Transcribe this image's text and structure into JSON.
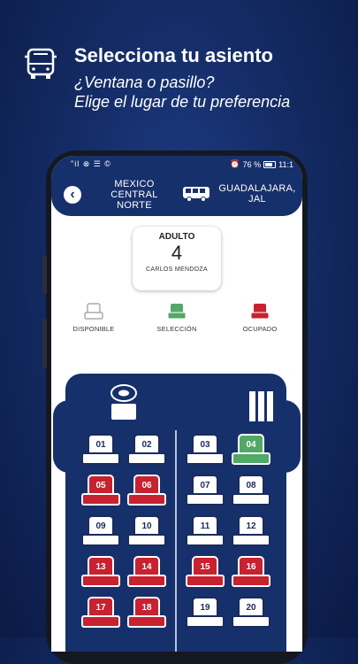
{
  "promo": {
    "title": "Selecciona tu asiento",
    "subtitle_line1": "¿Ventana o pasillo?",
    "subtitle_line2": "Elige el lugar de tu preferencia"
  },
  "status_bar": {
    "left": "\"il ⊗ ☰ ©",
    "battery": "76 %",
    "time": "11:1"
  },
  "header": {
    "origin": "MEXICO CENTRAL NORTE",
    "destination": "GUADALAJARA, JAL"
  },
  "passenger": {
    "type": "ADULTO",
    "number": "4",
    "name": "CARLOS MENDOZA"
  },
  "legend": {
    "available": "DISPONIBLE",
    "selected": "SELECCIÓN",
    "occupied": "OCUPADO"
  },
  "colors": {
    "brand_navy": "#16306b",
    "occupied_red": "#c8212f",
    "selected_green": "#52a866"
  },
  "seats": [
    {
      "number": "01",
      "status": "disponible"
    },
    {
      "number": "02",
      "status": "disponible"
    },
    {
      "number": "03",
      "status": "disponible"
    },
    {
      "number": "04",
      "status": "seleccion"
    },
    {
      "number": "05",
      "status": "ocupado"
    },
    {
      "number": "06",
      "status": "ocupado"
    },
    {
      "number": "07",
      "status": "disponible"
    },
    {
      "number": "08",
      "status": "disponible"
    },
    {
      "number": "09",
      "status": "disponible"
    },
    {
      "number": "10",
      "status": "disponible"
    },
    {
      "number": "11",
      "status": "disponible"
    },
    {
      "number": "12",
      "status": "disponible"
    },
    {
      "number": "13",
      "status": "ocupado"
    },
    {
      "number": "14",
      "status": "ocupado"
    },
    {
      "number": "15",
      "status": "ocupado"
    },
    {
      "number": "16",
      "status": "ocupado"
    },
    {
      "number": "17",
      "status": "ocupado"
    },
    {
      "number": "18",
      "status": "ocupado"
    },
    {
      "number": "19",
      "status": "disponible"
    },
    {
      "number": "20",
      "status": "disponible"
    }
  ]
}
